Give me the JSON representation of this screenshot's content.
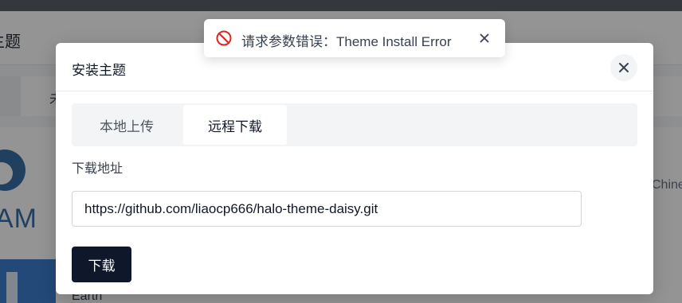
{
  "background": {
    "header_title": "主题",
    "tab_label": "未",
    "logo_text": "AM",
    "card_title": "Earth",
    "side_text": "Chinese"
  },
  "toast": {
    "icon": "block-icon",
    "message": "请求参数错误：Theme Install Error",
    "close_icon": "close-icon",
    "color": "#dc2626"
  },
  "modal": {
    "title": "安装主题",
    "close_icon": "close-icon",
    "tabs": [
      {
        "label": "本地上传",
        "active": false
      },
      {
        "label": "远程下载",
        "active": true
      }
    ],
    "field_label": "下载地址",
    "url_value": "https://github.com/liaocp666/halo-theme-daisy.git",
    "submit_label": "下载"
  },
  "colors": {
    "primary_button": "#0f172a",
    "overlay": "rgba(0,0,0,0.42)"
  }
}
